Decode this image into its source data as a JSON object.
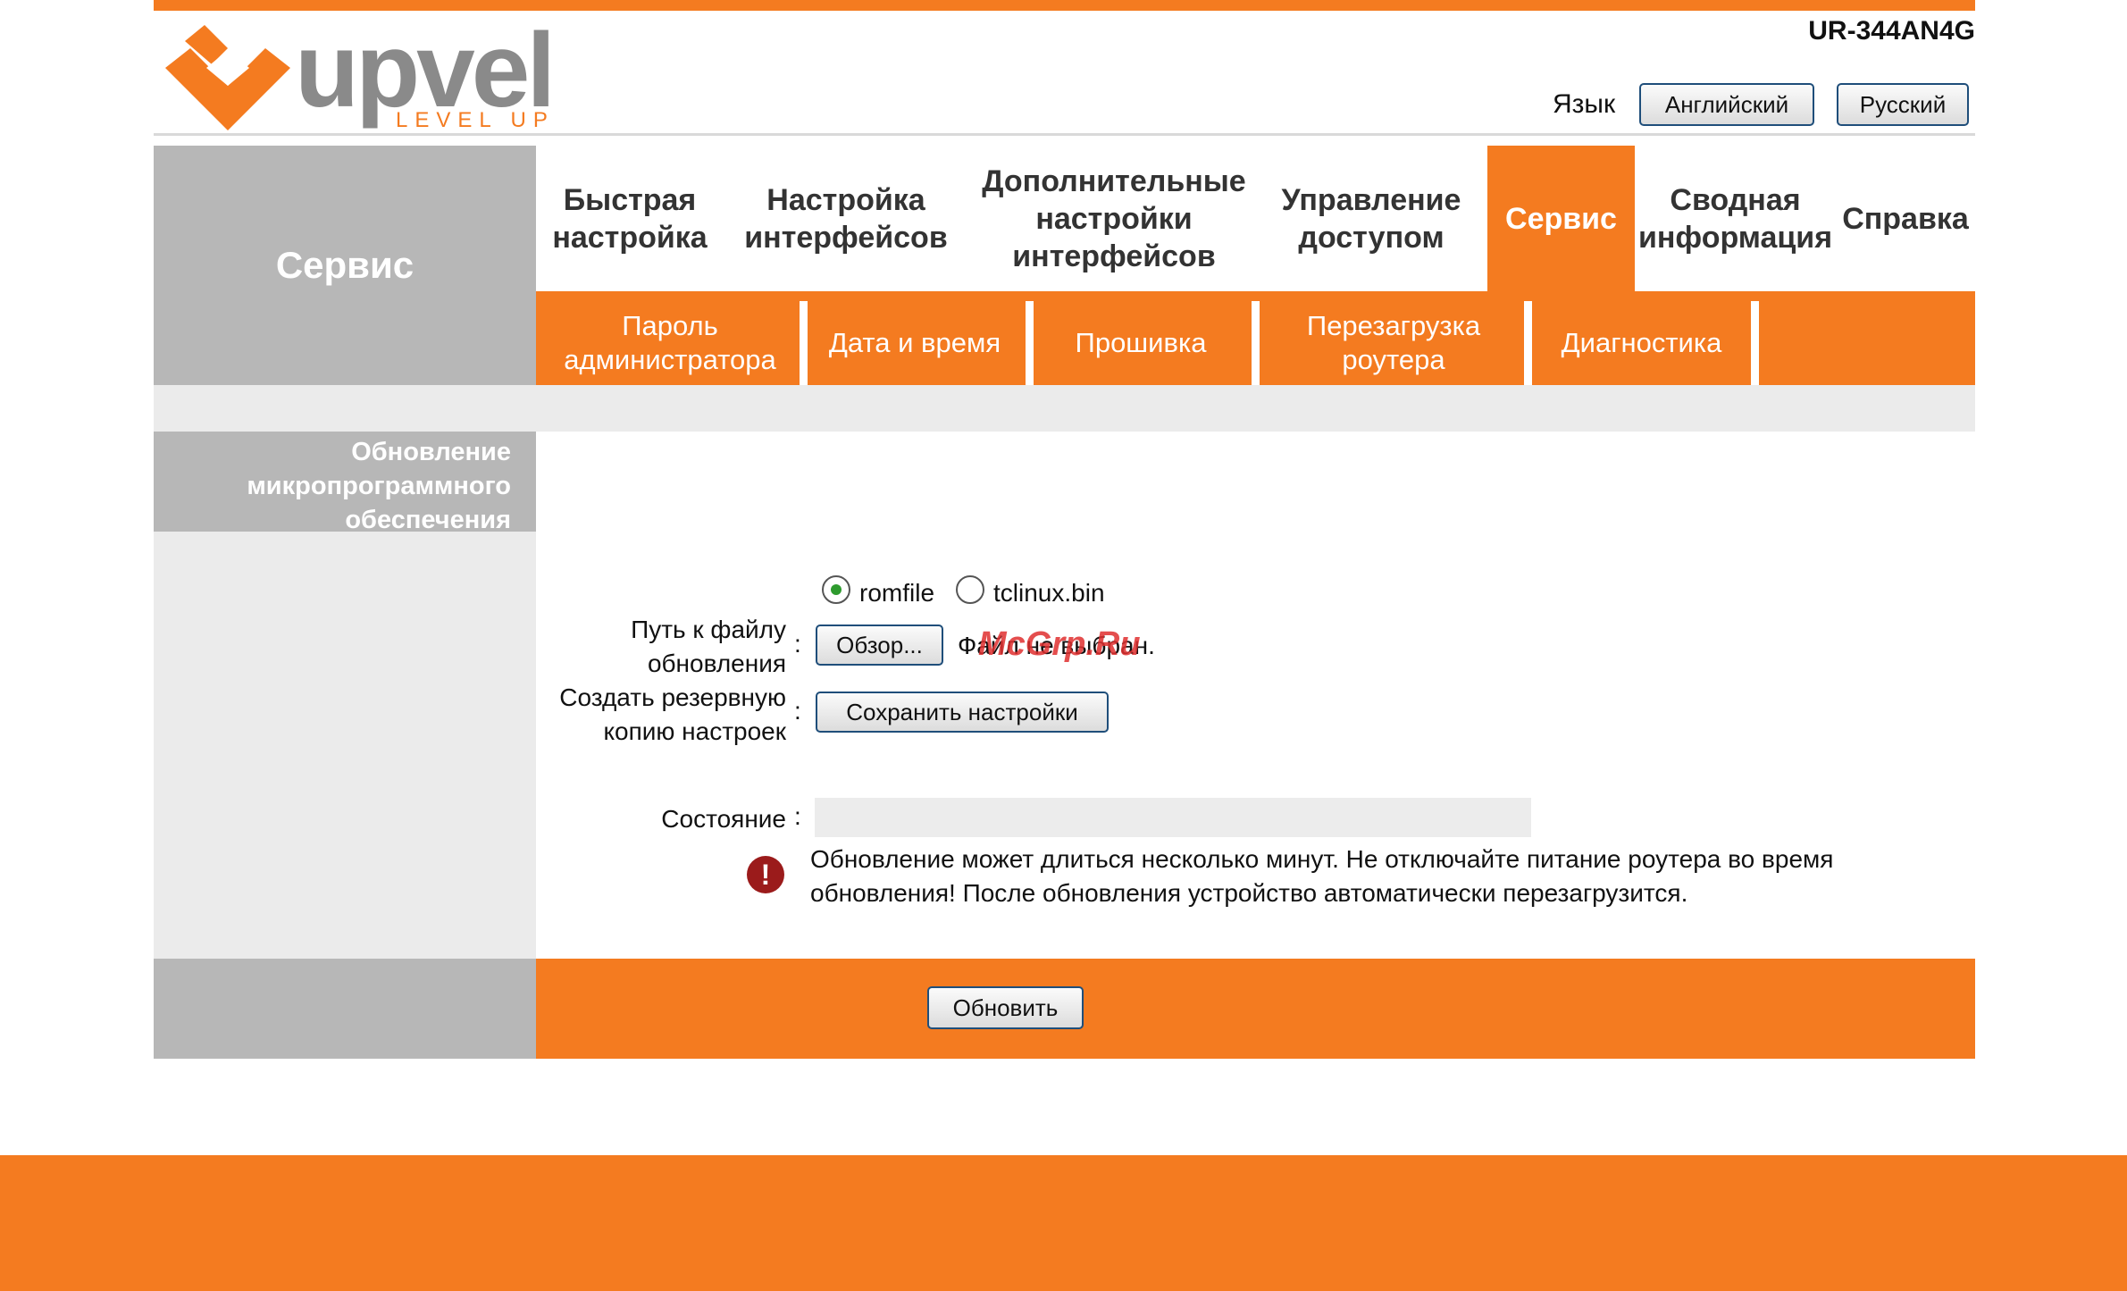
{
  "brand": {
    "logo_name": "upvel",
    "tagline": "LEVEL UP",
    "model": "UR-344AN4G",
    "accent": "#f47b20"
  },
  "language": {
    "label": "Язык",
    "english": "Английский",
    "russian": "Русский"
  },
  "sidebar": {
    "title": "Сервис",
    "section_title": "Обновление микропрограммного обеспечения"
  },
  "nav": {
    "items": [
      {
        "label": "Быстрая настройка"
      },
      {
        "label": "Настройка интерфейсов"
      },
      {
        "label": "Дополнительные настройки интерфейсов"
      },
      {
        "label": "Управление доступом"
      },
      {
        "label": "Сервис",
        "active": true
      },
      {
        "label": "Сводная информация"
      },
      {
        "label": "Справка"
      }
    ]
  },
  "subnav": {
    "items": [
      {
        "label": "Пароль администратора"
      },
      {
        "label": "Дата и время"
      },
      {
        "label": "Прошивка",
        "active": true
      },
      {
        "label": "Перезагрузка роутера"
      },
      {
        "label": "Диагностика"
      }
    ]
  },
  "form": {
    "radio_romfile": "romfile",
    "radio_tclinux": "tclinux.bin",
    "selected_radio": "romfile",
    "file_path_label": "Путь к файлу обновления",
    "browse_button": "Обзор...",
    "file_status": "Файл не выбран.",
    "backup_label": "Создать резервную копию настроек",
    "save_button": "Сохранить настройки",
    "state_label": "Состояние",
    "state_value": "",
    "colon": ":",
    "warning_text": "Обновление может длиться несколько минут. Не отключайте питание роутера во время обновления! После обновления устройство автоматически перезагрузится.",
    "update_button": "Обновить"
  },
  "watermark": "McGrp.Ru",
  "icons": {
    "warning": "exclamation-circle-icon",
    "logo_mark": "upvel-chevron-logo-icon"
  }
}
